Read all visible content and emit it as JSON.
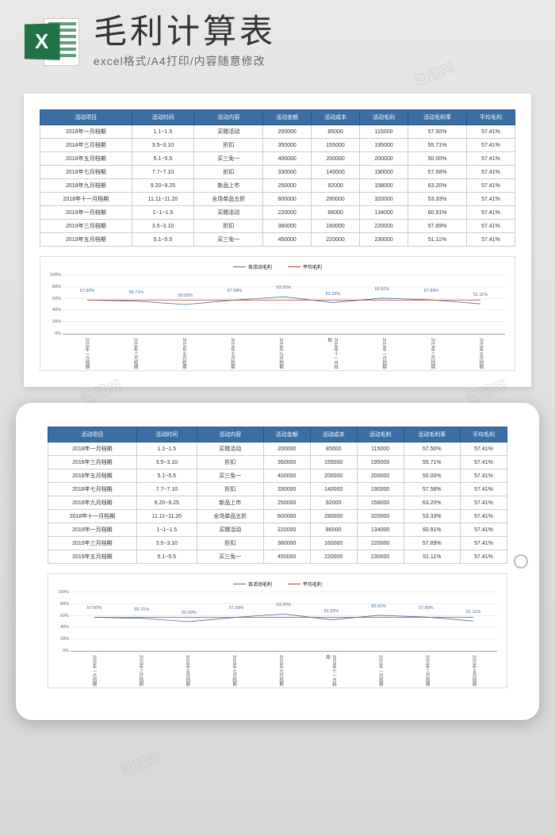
{
  "header": {
    "title": "毛利计算表",
    "subtitle": "excel格式/A4打印/内容随意修改"
  },
  "table": {
    "columns": [
      "活动项目",
      "活动时间",
      "活动内容",
      "活动金额",
      "活动成本",
      "活动毛利",
      "活动毛利率",
      "平均毛利"
    ],
    "rows": [
      [
        "2018年一月档期",
        "1.1~1.5",
        "买赠活动",
        "200000",
        "85000",
        "115000",
        "57.50%",
        "57.41%"
      ],
      [
        "2018年三月档期",
        "3.5~3.10",
        "折扣",
        "350000",
        "155000",
        "195000",
        "55.71%",
        "57.41%"
      ],
      [
        "2018年五月档期",
        "5.1~5.5",
        "买三免一",
        "400000",
        "200000",
        "200000",
        "50.00%",
        "57.41%"
      ],
      [
        "2018年七月档期",
        "7.7~7.10",
        "折扣",
        "330000",
        "140000",
        "190000",
        "57.58%",
        "57.41%"
      ],
      [
        "2018年九月档期",
        "9.20~9.25",
        "新品上市",
        "250000",
        "92000",
        "158000",
        "63.20%",
        "57.41%"
      ],
      [
        "2018年十一月档期",
        "11.11~11.20",
        "全场单品五折",
        "600000",
        "280000",
        "320000",
        "53.33%",
        "57.41%"
      ],
      [
        "2019年一月档期",
        "1~1~1.5",
        "买赠活动",
        "220000",
        "86000",
        "134000",
        "60.91%",
        "57.41%"
      ],
      [
        "2019年三月档期",
        "3.5~3.10",
        "折扣",
        "380000",
        "160000",
        "220000",
        "57.89%",
        "57.41%"
      ],
      [
        "2019年五月档期",
        "5.1~5.5",
        "买三免一",
        "450000",
        "220000",
        "230000",
        "51.11%",
        "57.41%"
      ]
    ]
  },
  "chart_data": {
    "type": "line",
    "title": "",
    "ylabel": "",
    "xlabel": "",
    "ylim": [
      0,
      100
    ],
    "yticks": [
      "0%",
      "20%",
      "40%",
      "60%",
      "80%",
      "100%"
    ],
    "categories": [
      "2018年一月档期",
      "2018年三月档期",
      "2018年五月档期",
      "2018年七月档期",
      "2018年九月档期",
      "2018年十一月档期",
      "2019年一月档期",
      "2019年三月档期",
      "2019年五月档期"
    ],
    "series": [
      {
        "name": "各活动毛利",
        "color": "#3a6ea5",
        "values": [
          57.5,
          55.71,
          50.0,
          57.58,
          63.2,
          53.33,
          60.91,
          57.89,
          51.11
        ]
      },
      {
        "name": "平均毛利",
        "color": "#c0392b",
        "values": [
          57.41,
          57.41,
          57.41,
          57.41,
          57.41,
          57.41,
          57.41,
          57.41,
          57.41
        ]
      }
    ],
    "data_labels": [
      "57.50%",
      "55.71%",
      "50.00%",
      "57.58%",
      "63.20%",
      "53.33%",
      "60.91%",
      "57.89%",
      "51.11%"
    ]
  },
  "watermark": "包图网"
}
